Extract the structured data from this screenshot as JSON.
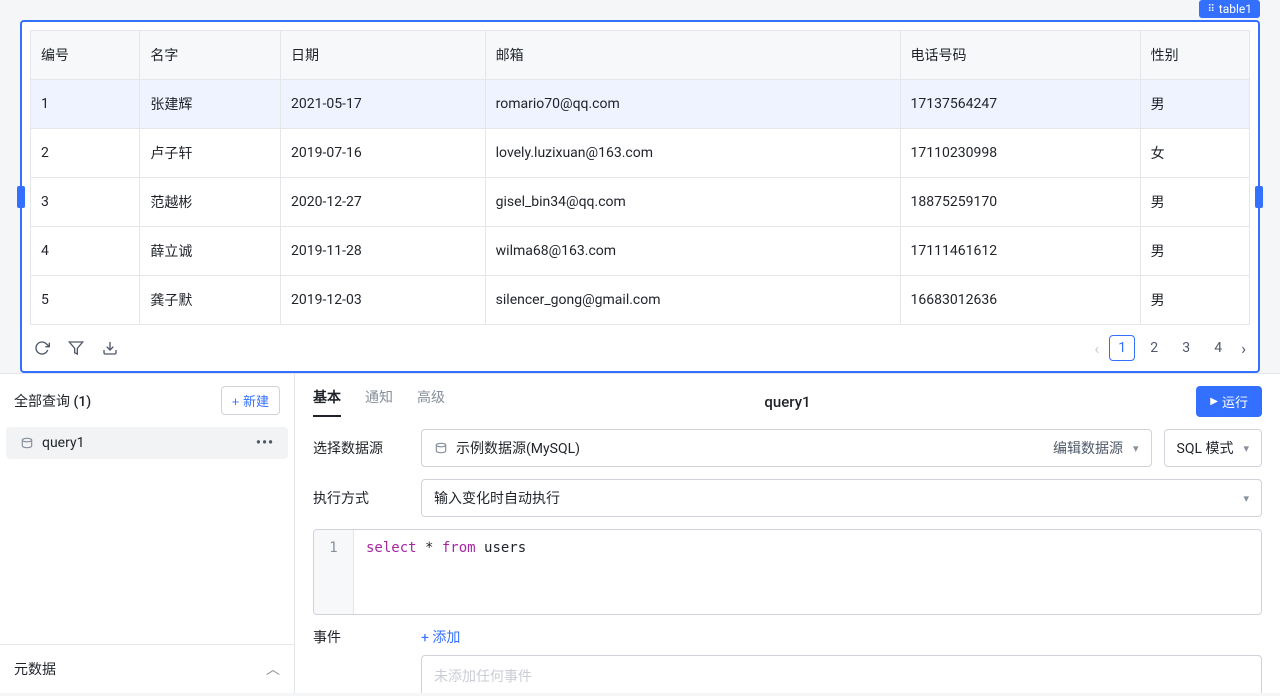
{
  "component_label": "table1",
  "table": {
    "columns": [
      "编号",
      "名字",
      "日期",
      "邮箱",
      "电话号码",
      "性别"
    ],
    "rows": [
      [
        "1",
        "张建辉",
        "2021-05-17",
        "romario70@qq.com",
        "17137564247",
        "男"
      ],
      [
        "2",
        "卢子轩",
        "2019-07-16",
        "lovely.luzixuan@163.com",
        "17110230998",
        "女"
      ],
      [
        "3",
        "范越彬",
        "2020-12-27",
        "gisel_bin34@qq.com",
        "18875259170",
        "男"
      ],
      [
        "4",
        "薛立诚",
        "2019-11-28",
        "wilma68@163.com",
        "17111461612",
        "男"
      ],
      [
        "5",
        "龚子默",
        "2019-12-03",
        "silencer_gong@gmail.com",
        "16683012636",
        "男"
      ]
    ],
    "pagination": {
      "pages": [
        "1",
        "2",
        "3",
        "4"
      ],
      "active": "1"
    }
  },
  "sidebar": {
    "title": "全部查询 (1)",
    "new_btn": "+ 新建",
    "query_name": "query1",
    "metadata_label": "元数据"
  },
  "editor": {
    "tabs": {
      "basic": "基本",
      "notify": "通知",
      "advanced": "高级"
    },
    "title": "query1",
    "run_label": "运行",
    "labels": {
      "datasource": "选择数据源",
      "exec_mode": "执行方式",
      "events": "事件"
    },
    "datasource": {
      "name": "示例数据源(MySQL)",
      "edit": "编辑数据源"
    },
    "sql_mode": "SQL 模式",
    "exec_mode_value": "输入变化时自动执行",
    "sql": {
      "keyword1": "select",
      "star": " * ",
      "keyword2": "from",
      "table": " users",
      "line": "1"
    },
    "add_event": "+ 添加",
    "events_empty": "未添加任何事件"
  }
}
